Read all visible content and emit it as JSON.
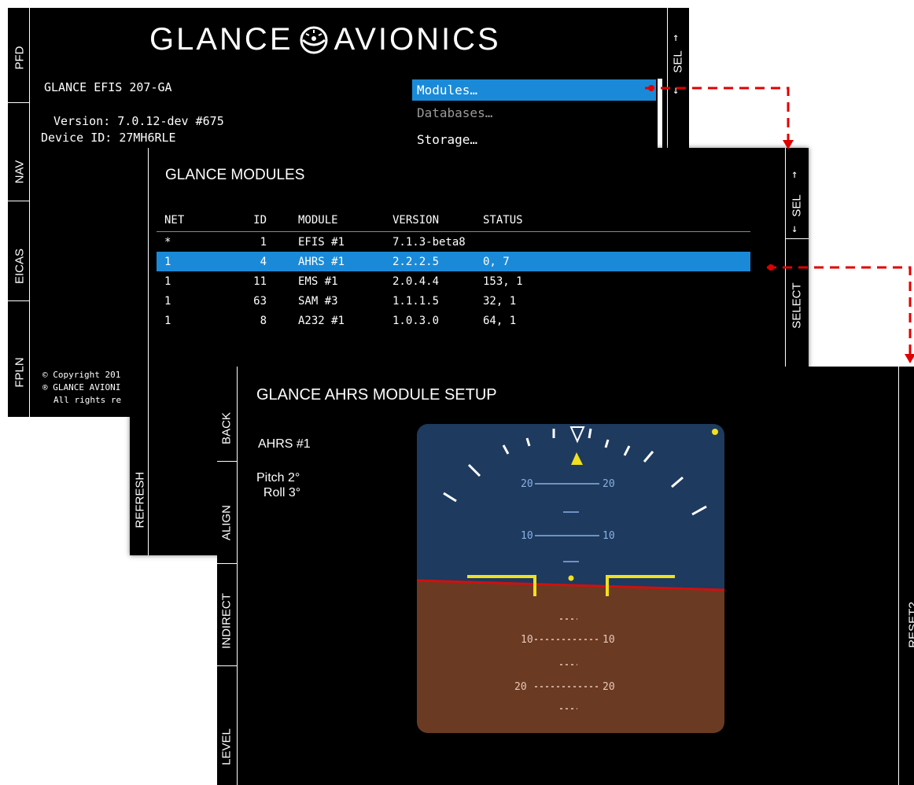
{
  "screen1": {
    "logo_left": "GLANCE",
    "logo_right": "AVIONICS",
    "device_name": "GLANCE EFIS 207-GA",
    "version": "Version: 7.0.12-dev #675",
    "device_id": "Device ID: 27MH6RLE",
    "copyright_lines": [
      "© Copyright 201",
      "® GLANCE AVIONI",
      "All rights re"
    ],
    "side_buttons": [
      "PFD",
      "NAV",
      "EICAS",
      "FPLN"
    ],
    "right_button": "SEL",
    "menu": [
      {
        "label": "Modules…",
        "state": "selected"
      },
      {
        "label": "Databases…",
        "state": "disabled"
      },
      {
        "label": "Storage…",
        "state": "normal"
      }
    ]
  },
  "screen2": {
    "title": "GLANCE MODULES",
    "headers": [
      "NET",
      "ID",
      "MODULE",
      "VERSION",
      "STATUS"
    ],
    "rows": [
      [
        "*",
        "1",
        "EFIS #1",
        "7.1.3-beta8",
        ""
      ],
      [
        "1",
        "4",
        "AHRS #1",
        "2.2.2.5",
        "0, 7"
      ],
      [
        "1",
        "11",
        "EMS #1",
        "2.0.4.4",
        "153, 1"
      ],
      [
        "1",
        "63",
        "SAM #3",
        "1.1.1.5",
        "32, 1"
      ],
      [
        "1",
        "8",
        "A232 #1",
        "1.0.3.0",
        "64, 1"
      ]
    ],
    "selected_row": 1,
    "left_button": "REFRESH",
    "right_buttons": [
      "SEL",
      "SELECT"
    ]
  },
  "screen3": {
    "title": "GLANCE AHRS MODULE SETUP",
    "module": "AHRS #1",
    "pitch": "Pitch 2°",
    "roll": "  Roll 3°",
    "left_buttons": [
      "BACK",
      "ALIGN",
      "INDIRECT",
      "LEVEL"
    ],
    "right_button": "RESET?",
    "pitch_labels": [
      "20",
      "10",
      "10",
      "20"
    ],
    "colors": {
      "sky": "#1e3a5f",
      "ground": "#6b3a23",
      "horizon": "#d01010",
      "symbol": "#f0e020",
      "pitch_text": "#8ab0e0"
    }
  },
  "colors": {
    "selection": "#1a8ad8",
    "connector": "#e00000"
  }
}
